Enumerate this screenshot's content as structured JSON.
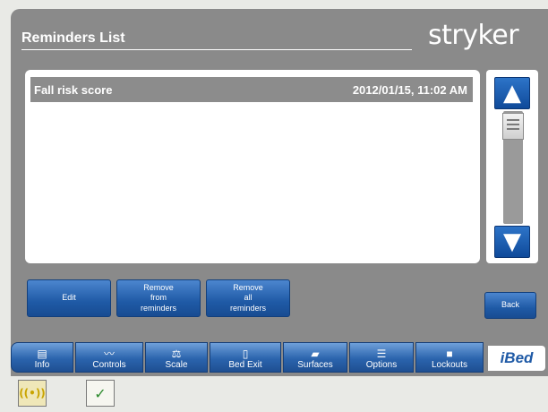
{
  "header": {
    "title": "Reminders List",
    "logo_text": "stryker"
  },
  "reminders": [
    {
      "name": "Fall risk score",
      "timestamp": "2012/01/15, 11:02 AM"
    }
  ],
  "scroll": {
    "up_icon": "triangle-up",
    "down_icon": "triangle-down"
  },
  "actions": {
    "edit": "Edit",
    "remove": "Remove\nfrom\nreminders",
    "remove_all": "Remove\nall\nreminders",
    "back": "Back"
  },
  "nav": {
    "info": "Info",
    "controls": "Controls",
    "scale": "Scale",
    "bed_exit": "Bed Exit",
    "surfaces": "Surfaces",
    "options": "Options",
    "lockouts": "Lockouts",
    "brand": "iBed"
  },
  "colors": {
    "button_blue": "#1f5aa6",
    "panel_gray": "#8a8a8a",
    "row_highlight": "#8c8c8c"
  }
}
